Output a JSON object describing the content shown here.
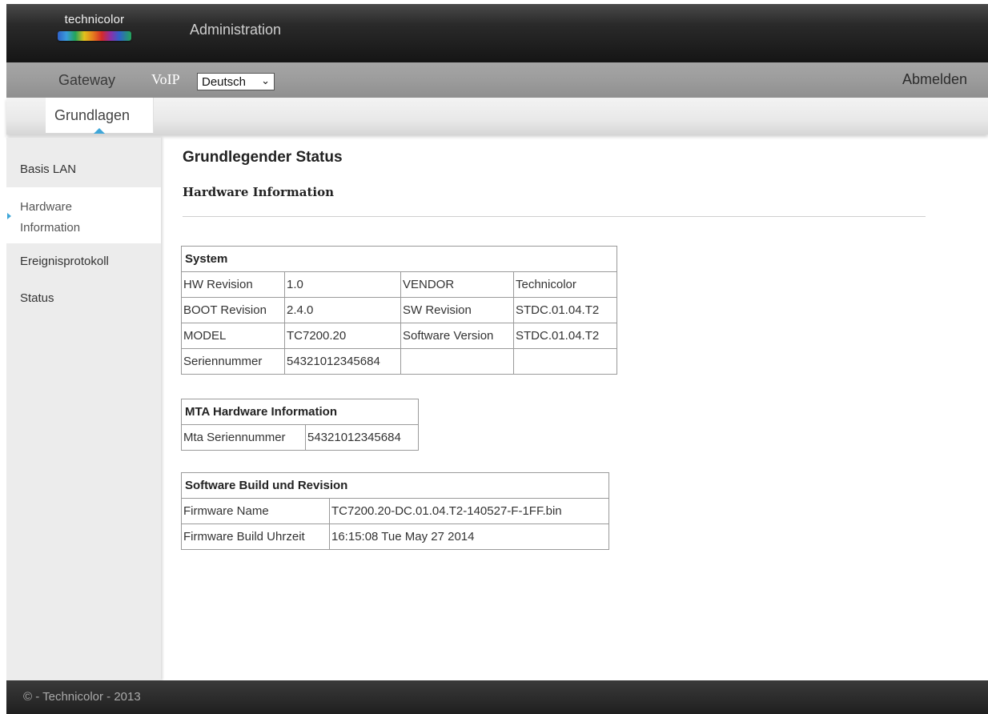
{
  "header": {
    "logo_text": "technicolor",
    "title": "Administration"
  },
  "nav": {
    "gateway": "Gateway",
    "voip": "VoIP",
    "language": "Deutsch",
    "logout": "Abmelden"
  },
  "subnav": {
    "tab": "Grundlagen"
  },
  "sidebar": {
    "items": [
      {
        "label": "Basis LAN"
      },
      {
        "label_line1": "Hardware",
        "label_line2": "Information"
      },
      {
        "label": "Ereignisprotokoll"
      },
      {
        "label": "Status"
      }
    ]
  },
  "main": {
    "title": "Grundlegender Status",
    "subtitle": "Hardware Information"
  },
  "system": {
    "header": "System",
    "rows": [
      [
        "HW Revision",
        "1.0",
        "VENDOR",
        "Technicolor"
      ],
      [
        "BOOT Revision",
        "2.4.0",
        "SW Revision",
        "STDC.01.04.T2"
      ],
      [
        "MODEL",
        "TC7200.20",
        "Software Version",
        "STDC.01.04.T2"
      ],
      [
        "Seriennummer",
        "54321012345684",
        "",
        ""
      ]
    ]
  },
  "mta": {
    "header": "MTA Hardware Information",
    "rows": [
      [
        "Mta Seriennummer",
        "54321012345684"
      ]
    ]
  },
  "software": {
    "header": "Software Build und Revision",
    "rows": [
      [
        "Firmware Name",
        "TC7200.20-DC.01.04.T2-140527-F-1FF.bin"
      ],
      [
        "Firmware Build Uhrzeit",
        "16:15:08 Tue May 27 2014"
      ]
    ]
  },
  "footer": {
    "text": "© - Technicolor - 2013"
  }
}
